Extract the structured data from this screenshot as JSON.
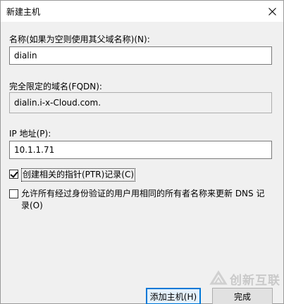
{
  "window": {
    "title": "新建主机",
    "close_icon": "close-icon"
  },
  "name_field": {
    "label": "名称(如果为空则使用其父域名称)(N):",
    "value": "dialin"
  },
  "fqdn": {
    "label": "完全限定的域名(FQDN):",
    "value": "dialin.i-x-Cloud.com."
  },
  "ip_field": {
    "label": "IP 地址(P):",
    "value": "10.1.1.71"
  },
  "options": {
    "create_ptr": {
      "label": "创建相关的指针(PTR)记录(C)",
      "checked": true
    },
    "allow_update": {
      "label_line1": "允许所有经过身份验证的用户用相同的所有者名称来更新 DNS 记",
      "label_line2": "录(O)",
      "checked": false
    }
  },
  "buttons": {
    "add_host": "添加主机(H)",
    "done": "完成"
  },
  "watermark": {
    "text": "创新互联",
    "icon": "brand-logo-icon"
  }
}
